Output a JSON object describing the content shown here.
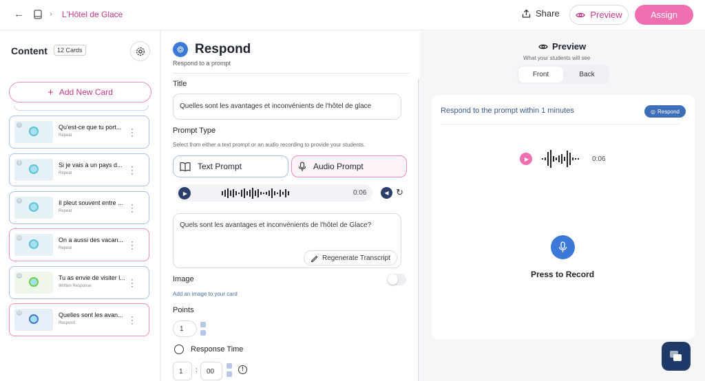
{
  "header": {
    "back_icon": "arrow-left-icon",
    "book_icon": "book-icon",
    "chevron_icon": "chevron-right-icon",
    "breadcrumb": "L'Hôtel de Glace",
    "share_label": "Share",
    "preview_label": "Preview",
    "assign_label": "Assign",
    "accent": "#c2398a",
    "assign_color": "#ef6fb0"
  },
  "sidebar": {
    "title": "Content",
    "count": "12 Cards",
    "add_label": "Add New Card",
    "cards": [
      {
        "num": "7",
        "title": "Qu'est-ce que tu port...",
        "type": "Repeat",
        "color": "#5bc3d9"
      },
      {
        "num": "8",
        "title": "Si je vais à un pays d...",
        "type": "Repeat",
        "color": "#5bc3d9"
      },
      {
        "num": "9",
        "title": "Il pleut souvent entre ...",
        "type": "Repeat",
        "color": "#5bc3d9"
      },
      {
        "num": "10",
        "title": "On a aussi des vacan...",
        "type": "Repeat",
        "color": "#5bc3d9"
      },
      {
        "num": "11",
        "title": "Tu as envie de visiter l...",
        "type": "Written Response",
        "color": "#6ad04b"
      },
      {
        "num": "12",
        "title": "Quelles sont les avan...",
        "type": "Respond",
        "color": "#3c78d8"
      }
    ]
  },
  "editor": {
    "heading": "Respond",
    "subheading": "Respond to a prompt",
    "title_label": "Title",
    "title_value": "Quelles sont les avantages et inconvénients de l'hôtel de glace",
    "prompt_type_label": "Prompt Type",
    "prompt_type_help": "Select from either a text prompt or an audio recording to provide your students.",
    "text_prompt": "Text Prompt",
    "audio_prompt": "Audio Prompt",
    "audio_time": "0:06",
    "transcript": "Quels sont les avantages et inconvénients de l'hôtel de Glace?",
    "regen_label": "Regenerate Transcript",
    "image_label": "Image",
    "image_help": "Add an image to your card",
    "points_label": "Points",
    "points_value": "1",
    "response_time_label": "Response Time",
    "minutes": "1",
    "seconds": "00",
    "colon": ":"
  },
  "preview": {
    "heading": "Preview",
    "subheading": "What your students will see",
    "front": "Front",
    "back": "Back",
    "prompt_text": "Respond to the prompt within 1 minutes",
    "badge": "Respond",
    "audio_time": "0:06",
    "record_label": "Press to Record"
  }
}
